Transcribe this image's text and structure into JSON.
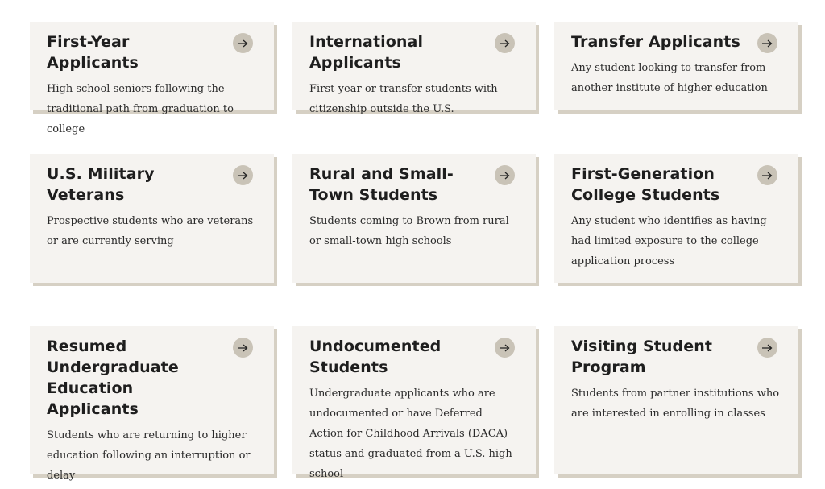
{
  "cards": [
    {
      "title": "First-Year Applicants",
      "description": "High school seniors following the traditional path from graduation to college"
    },
    {
      "title": "International Applicants",
      "description": "First-year or transfer students with citizenship outside the U.S."
    },
    {
      "title": "Transfer Applicants",
      "description": "Any student looking to transfer from another institute of higher education"
    },
    {
      "title": "U.S. Military Veterans",
      "description": "Prospective students who are veterans or are currently serving"
    },
    {
      "title": "Rural and Small-Town Students",
      "description": "Students coming to Brown from rural or small-town high schools"
    },
    {
      "title": "First-Generation College Students",
      "description": "Any student who identifies as having had limited exposure to the college application process"
    },
    {
      "title": "Resumed Undergraduate Education Applicants",
      "description": "Students who are returning to higher education following an interruption or delay"
    },
    {
      "title": "Undocumented Students",
      "description": "Undergraduate applicants who are undocumented or have Deferred Action for Childhood Arrivals (DACA) status and graduated from a U.S. high school"
    },
    {
      "title": "Visiting Student Program",
      "description": "Students from partner institutions who are interested in enrolling in classes"
    }
  ],
  "icons": {
    "arrow": "arrow-right-icon"
  },
  "colors": {
    "card_bg": "#f5f3f0",
    "card_shadow": "#d6d0c4",
    "arrow_circle": "#c9c3b7"
  }
}
